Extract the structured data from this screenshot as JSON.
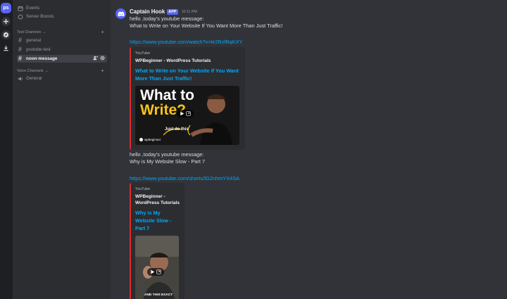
{
  "rail": {
    "server_initials": "ps"
  },
  "sidebar": {
    "top_items": [
      {
        "label": "Events",
        "icon": "calendar-icon"
      },
      {
        "label": "Server Boosts",
        "icon": "boost-icon"
      }
    ],
    "text_category": "Text Channels",
    "text_channels": [
      "general",
      "youtube-test",
      "noon-message"
    ],
    "active_channel": "noon-message",
    "voice_category": "Voice Channels",
    "voice_channels": [
      "General"
    ]
  },
  "message": {
    "author": "Captain Hook",
    "badge": "APP",
    "timestamp": "10:11 PM",
    "blocks": [
      {
        "line1": "hello ,today's youtube message:",
        "line2": " What to Write on Your Website If You Want More Than Just Traffic!",
        "url": "https://www.youtube.com/watch?v=le2RzfBqKXY",
        "embed": {
          "provider": "YouTube",
          "channel": "WPBeginner - WordPress Tutorials",
          "title_lines": [
            "What to Write on Your Website If You Want",
            "More Than Just Traffic!"
          ],
          "thumb_line1": "What to",
          "thumb_line2": "Write?",
          "thumb_caption": "Just do this",
          "thumb_brand": "wpbeginner"
        }
      },
      {
        "line1": "hello ,today's youtube message:",
        "line2": " Why is My Website Slow - Part 7",
        "url": "https://www.youtube.com/shorts/lG2nhmYX4SA",
        "embed": {
          "provider": "YouTube",
          "channel_lines": [
            "WPBeginner -",
            "WordPress Tutorials"
          ],
          "title_lines": [
            "Why is My",
            "Website Slow -",
            "Part 7"
          ],
          "thumb_caption": "AND THIS EXACT"
        }
      }
    ]
  },
  "colors": {
    "accent": "#5865f2",
    "link": "#00a8fc",
    "youtube": "#e02a2a",
    "thumb_yellow": "#f5c518"
  }
}
